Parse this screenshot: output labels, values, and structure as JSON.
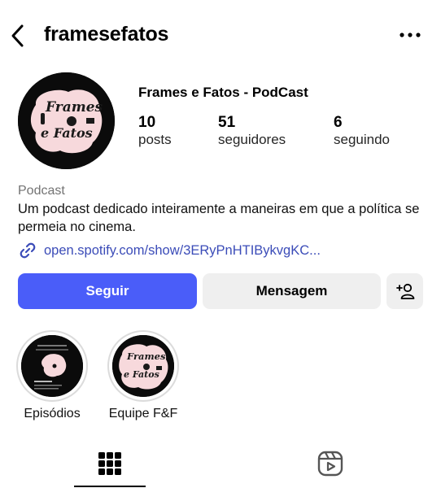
{
  "header": {
    "username": "framesefatos",
    "back_icon": "chevron-left-icon",
    "more_icon": "ellipsis-icon"
  },
  "profile": {
    "display_name": "Frames e Fatos - PodCast",
    "avatar_text_line1": "Frames",
    "avatar_text_line2": "e Fatos",
    "stats": [
      {
        "number": "10",
        "label": "posts"
      },
      {
        "number": "51",
        "label": "seguidores"
      },
      {
        "number": "6",
        "label": "seguindo"
      }
    ],
    "category": "Podcast",
    "bio": "Um podcast dedicado inteiramente a maneiras em que a política se permeia no cinema.",
    "link": "open.spotify.com/show/3ERyPnHTIBykvgKC..."
  },
  "actions": {
    "follow_label": "Seguir",
    "message_label": "Mensagem",
    "add_user_icon": "add-user-icon"
  },
  "highlights": [
    {
      "label": "Episódios"
    },
    {
      "label": "Equipe F&F"
    }
  ],
  "tabs": [
    {
      "icon": "grid-icon",
      "active": true
    },
    {
      "icon": "reels-icon",
      "active": false
    }
  ],
  "colors": {
    "accent": "#4a5df9",
    "link": "#3b4cb8",
    "button_grey": "#efefef",
    "logo_pink": "#f7d9dc"
  }
}
